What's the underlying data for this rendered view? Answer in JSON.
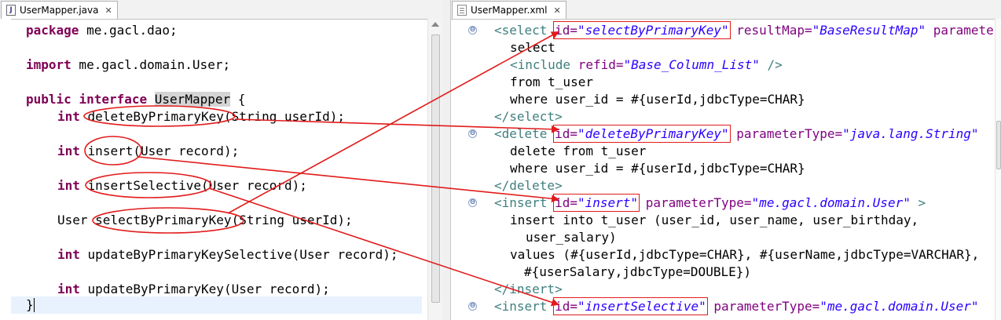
{
  "left_tab": {
    "title": "UserMapper.java",
    "close": "✕"
  },
  "right_tab": {
    "title": "UserMapper.xml",
    "close": "✕"
  },
  "java": {
    "l1": {
      "kw": "package",
      "rest": " me.gacl.dao;"
    },
    "l2": {
      "kw": "import",
      "rest": " me.gacl.domain.User;"
    },
    "l3": {
      "kw1": "public",
      "kw2": "interface",
      "name": "UserMapper",
      "brace": " {"
    },
    "m1": {
      "type": "int",
      "name": "deleteByPrimaryKey",
      "rest": "(String userId);"
    },
    "m2": {
      "type": "int",
      "name": "insert",
      "rest": "(User record);"
    },
    "m3": {
      "type": "int",
      "name": "insertSelective",
      "rest": "(User record);"
    },
    "m4": {
      "type": "User",
      "name": "selectByPrimaryKey",
      "rest": "(String userId);"
    },
    "m5": {
      "type": "int",
      "name": "updateByPrimaryKeySelective",
      "rest": "(User record);"
    },
    "m6": {
      "type": "int",
      "name": "updateByPrimaryKey",
      "rest": "(User record);"
    },
    "end": "}"
  },
  "xml": {
    "select_open": {
      "lt": "<select",
      "id_attr": "id=",
      "id_val": "\"selectByPrimaryKey\"",
      "attr2": "resultMap=",
      "val2": "\"BaseResultMap\"",
      "attr3": "paramete"
    },
    "select_kw": "select",
    "include": {
      "lt": "<include",
      "attr": "refid=",
      "val": "\"Base_Column_List\"",
      "end": " />"
    },
    "from": "from t_user",
    "where1": "where user_id = #{userId,jdbcType=CHAR}",
    "select_close": "</select>",
    "delete_open": {
      "lt": "<delete",
      "id_attr": "id=",
      "id_val": "\"deleteByPrimaryKey\"",
      "attr2": "parameterType=",
      "val2": "\"java.lang.String\""
    },
    "delete_kw": "delete from t_user",
    "where2": "where user_id = #{userId,jdbcType=CHAR}",
    "delete_close": "</delete>",
    "insert_open": {
      "lt": "<insert",
      "id_attr": "id=",
      "id_val": "\"insert\"",
      "attr2": "parameterType=",
      "val2": "\"me.gacl.domain.User\"",
      "end": " >"
    },
    "insert_into": "insert into t_user (user_id, user_name, user_birthday,",
    "insert_cols2": "user_salary)",
    "values1": "values (#{userId,jdbcType=CHAR}, #{userName,jdbcType=VARCHAR},",
    "values2": "#{userSalary,jdbcType=DOUBLE})",
    "insert_close": "</insert>",
    "insertsel_open": {
      "lt": "<insert",
      "id_attr": "id=",
      "id_val": "\"insertSelective\"",
      "attr2": "parameterType=",
      "val2": "\"me.gacl.domain.User\""
    }
  },
  "colors": {
    "keyword": "#7f0055",
    "tag": "#3f7f7f",
    "attribute": "#7f007f",
    "string": "#2a00ff",
    "annotation": "#e21b1b"
  },
  "icons": {
    "java_file": "J",
    "xml_file": "xml-file-icon",
    "fold": "⊖"
  }
}
